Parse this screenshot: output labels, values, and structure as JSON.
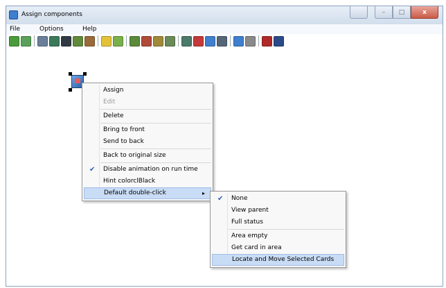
{
  "window": {
    "title": "Assign components"
  },
  "caption_buttons": {
    "help": "",
    "minimize": "–",
    "maximize": "□",
    "close": "x"
  },
  "menubar": [
    "File",
    "Options",
    "Help"
  ],
  "toolbar": {
    "icons": [
      {
        "name": "people-icon",
        "color": "#4a9b3a"
      },
      {
        "name": "people-group-icon",
        "color": "#5aa05a"
      },
      {
        "name": "server-icon",
        "color": "#6a7f9a"
      },
      {
        "name": "network-icon",
        "color": "#3a7a5a"
      },
      {
        "name": "monitor-icon",
        "color": "#2f3a44"
      },
      {
        "name": "terminal-icon",
        "color": "#5f8a3a"
      },
      {
        "name": "reader-icon",
        "color": "#9a6a3a"
      },
      {
        "name": "lightbulb-icon",
        "color": "#e3c23a"
      },
      {
        "name": "device-icon",
        "color": "#7ab04a"
      },
      {
        "name": "controller-icon",
        "color": "#5a8a3a"
      },
      {
        "name": "controller-red-icon",
        "color": "#b04a3a"
      },
      {
        "name": "user-icon",
        "color": "#a08a3a"
      },
      {
        "name": "printer-icon",
        "color": "#6a8a5a"
      },
      {
        "name": "screen-icon",
        "color": "#4a7a6a"
      },
      {
        "name": "door-icon",
        "color": "#c43a3a"
      },
      {
        "name": "card-icon",
        "color": "#3f7fcf"
      },
      {
        "name": "person-icon",
        "color": "#556677"
      },
      {
        "name": "window-icon",
        "color": "#3f7fcf"
      },
      {
        "name": "settings-icon",
        "color": "#8a8a8a"
      },
      {
        "name": "camera-icon",
        "color": "#b02a2a"
      },
      {
        "name": "display-icon",
        "color": "#2a4a8a"
      }
    ]
  },
  "context_menu": {
    "items": [
      {
        "label": "Assign",
        "disabled": false
      },
      {
        "label": "Edit",
        "disabled": true
      },
      {
        "label": "Delete",
        "disabled": false
      },
      {
        "label": "Bring to front",
        "disabled": false
      },
      {
        "label": "Send to back",
        "disabled": false
      },
      {
        "label": "Back to original size",
        "disabled": false
      },
      {
        "label": "Disable animation on run time",
        "checked": true
      },
      {
        "label": "Hint colorclBlack",
        "disabled": false
      },
      {
        "label": "Default double-click",
        "has_submenu": true,
        "highlighted": true
      }
    ],
    "check_glyph": "✔",
    "arrow_glyph": "▸"
  },
  "submenu": {
    "items": [
      {
        "label": "None",
        "checked": true
      },
      {
        "label": "View parent"
      },
      {
        "label": "Full status"
      },
      {
        "label": "Area empty"
      },
      {
        "label": "Get card in area"
      },
      {
        "label": "Locate and Move Selected Cards",
        "highlighted": true
      }
    ]
  }
}
